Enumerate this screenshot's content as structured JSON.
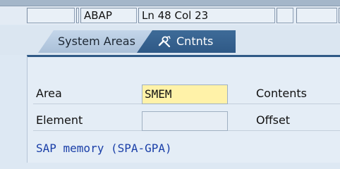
{
  "status_bar": {
    "cells": [
      "",
      "",
      "ABAP",
      "Ln  48 Col  23",
      "",
      "",
      ""
    ]
  },
  "tabs": [
    {
      "label": "System Areas",
      "selected": false
    },
    {
      "label": "Cntnts",
      "selected": true,
      "icon": "tools-icon"
    }
  ],
  "form": {
    "area_label": "Area",
    "area_value": "SMEM",
    "contents_label": "Contents",
    "element_label": "Element",
    "element_value": "",
    "offset_label": "Offset"
  },
  "description": "SAP memory (SPA-GPA)",
  "colors": {
    "active_tab": "#2f5986",
    "input_highlight": "#fff2a8",
    "description_text": "#1a3fa8"
  }
}
